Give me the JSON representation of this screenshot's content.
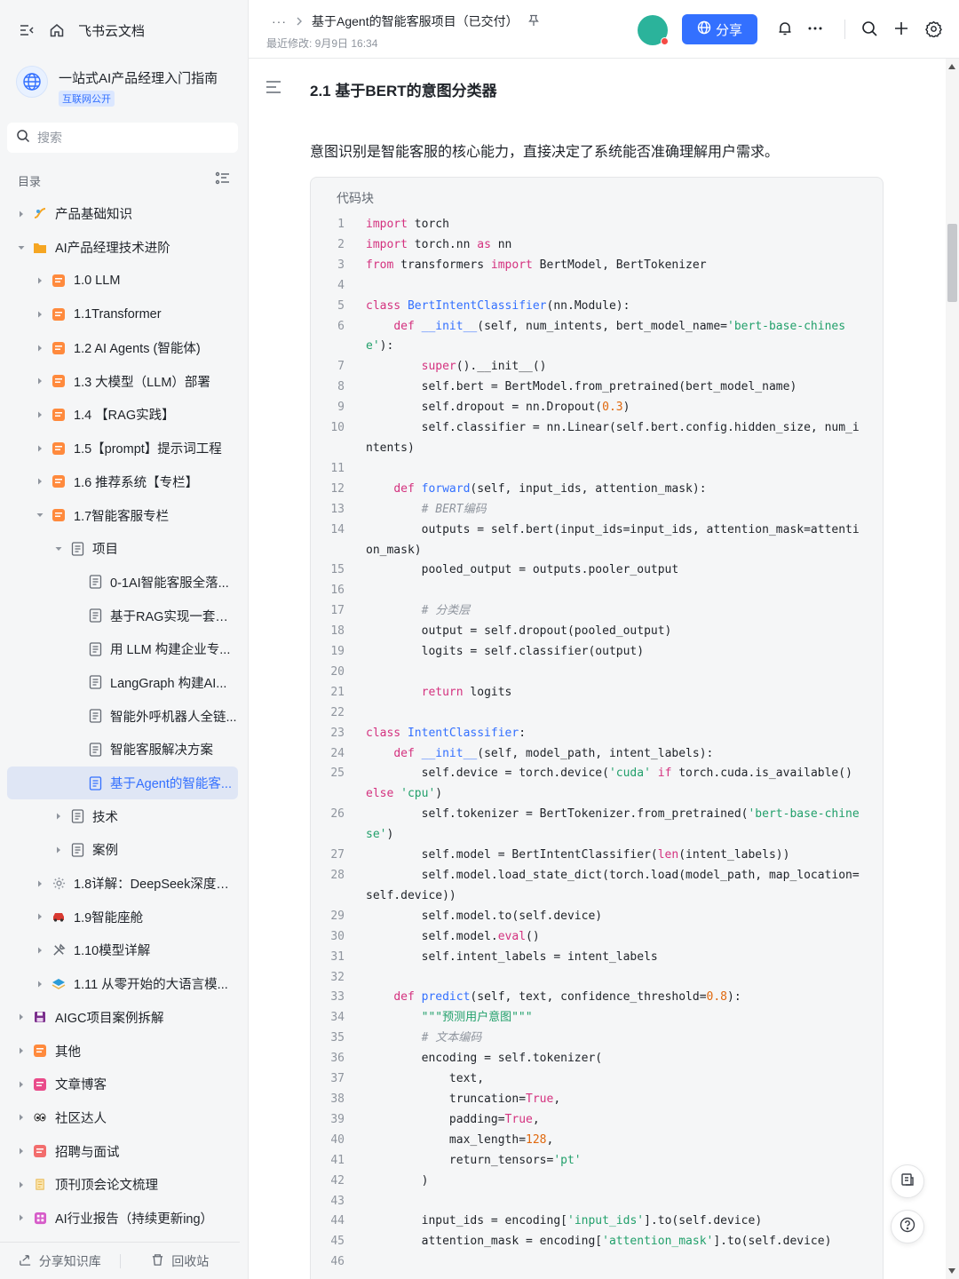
{
  "sidebar": {
    "brand": "飞书云文档",
    "kb_title": "一站式AI产品经理入门指南",
    "kb_badge": "互联网公开",
    "search_placeholder": "搜索",
    "toc_label": "目录",
    "tree": [
      {
        "label": "产品基础知识",
        "level": 0,
        "arrow": "right",
        "icon": "light-icon",
        "color": "#f5a623"
      },
      {
        "label": "AI产品经理技术进阶",
        "level": 0,
        "arrow": "down",
        "icon": "folder-icon",
        "color": "#f5a623"
      },
      {
        "label": "1.0 LLM",
        "level": 1,
        "arrow": "right",
        "icon": "doc-icon",
        "color": "#ff8a3d"
      },
      {
        "label": "1.1Transformer",
        "level": 1,
        "arrow": "right",
        "icon": "doc-icon",
        "color": "#ff8a3d"
      },
      {
        "label": "1.2 AI Agents (智能体)",
        "level": 1,
        "arrow": "right",
        "icon": "doc-icon",
        "color": "#ff8a3d"
      },
      {
        "label": "1.3 大模型（LLM）部署",
        "level": 1,
        "arrow": "right",
        "icon": "doc-icon",
        "color": "#ff8a3d"
      },
      {
        "label": "1.4 【RAG实践】",
        "level": 1,
        "arrow": "right",
        "icon": "doc-icon",
        "color": "#ff8a3d"
      },
      {
        "label": "1.5【prompt】提示词工程",
        "level": 1,
        "arrow": "right",
        "icon": "doc-icon",
        "color": "#ff8a3d"
      },
      {
        "label": "1.6 推荐系统【专栏】",
        "level": 1,
        "arrow": "right",
        "icon": "doc-icon",
        "color": "#ff8a3d"
      },
      {
        "label": "1.7智能客服专栏",
        "level": 1,
        "arrow": "down",
        "icon": "doc-icon",
        "color": "#ff8a3d"
      },
      {
        "label": "项目",
        "level": 2,
        "arrow": "down",
        "icon": "page-icon",
        "color": "#646a73"
      },
      {
        "label": "0-1AI智能客服全落...",
        "level": 3,
        "arrow": "none",
        "icon": "page-icon",
        "color": "#646a73"
      },
      {
        "label": "基于RAG实现一套企...",
        "level": 3,
        "arrow": "none",
        "icon": "page-icon",
        "color": "#646a73"
      },
      {
        "label": "用 LLM 构建企业专...",
        "level": 3,
        "arrow": "none",
        "icon": "page-icon",
        "color": "#646a73"
      },
      {
        "label": "LangGraph 构建AI...",
        "level": 3,
        "arrow": "none",
        "icon": "page-icon",
        "color": "#646a73"
      },
      {
        "label": "智能外呼机器人全链...",
        "level": 3,
        "arrow": "none",
        "icon": "page-icon",
        "color": "#646a73"
      },
      {
        "label": "智能客服解决方案",
        "level": 3,
        "arrow": "none",
        "icon": "page-icon",
        "color": "#646a73"
      },
      {
        "label": "基于Agent的智能客...",
        "level": 3,
        "arrow": "none",
        "icon": "page-icon",
        "color": "#3370ff",
        "active": true
      },
      {
        "label": "技术",
        "level": 2,
        "arrow": "right",
        "icon": "page-icon",
        "color": "#646a73"
      },
      {
        "label": "案例",
        "level": 2,
        "arrow": "right",
        "icon": "page-icon",
        "color": "#646a73"
      },
      {
        "label": "1.8详解：DeepSeek深度推...",
        "level": 1,
        "arrow": "right",
        "icon": "gear-icon",
        "color": "#8f959e"
      },
      {
        "label": "1.9智能座舱",
        "level": 1,
        "arrow": "right",
        "icon": "car-icon",
        "color": "#d83931"
      },
      {
        "label": "1.10模型详解",
        "level": 1,
        "arrow": "right",
        "icon": "tools-icon",
        "color": "#646a73"
      },
      {
        "label": "1.11 从零开始的大语言模...",
        "level": 1,
        "arrow": "right",
        "icon": "layers-icon",
        "color": "#2b9cd8"
      },
      {
        "label": "AIGC项目案例拆解",
        "level": 0,
        "arrow": "right",
        "icon": "save-icon",
        "color": "#7a2e8c"
      },
      {
        "label": "其他",
        "level": 0,
        "arrow": "right",
        "icon": "doc-icon",
        "color": "#ff8a3d"
      },
      {
        "label": "文章博客",
        "level": 0,
        "arrow": "right",
        "icon": "doc-icon",
        "color": "#e94b8a"
      },
      {
        "label": "社区达人",
        "level": 0,
        "arrow": "right",
        "icon": "eyes-icon",
        "color": "#1f2329"
      },
      {
        "label": "招聘与面试",
        "level": 0,
        "arrow": "right",
        "icon": "doc-icon",
        "color": "#f26d6d"
      },
      {
        "label": "顶刊顶会论文梳理",
        "level": 0,
        "arrow": "right",
        "icon": "scroll-icon",
        "color": "#e8b54a"
      },
      {
        "label": "AI行业报告（持续更新ing）",
        "level": 0,
        "arrow": "right",
        "icon": "grid-icon",
        "color": "#d65cc9"
      }
    ],
    "bottom": {
      "share_label": "分享知识库",
      "trash_label": "回收站"
    }
  },
  "header": {
    "breadcrumb_ellipsis": "···",
    "doc_title": "基于Agent的智能客服项目（已交付）",
    "modified": "最近修改: 9月9日 16:34",
    "share_label": "分享"
  },
  "content": {
    "heading": "2.1 基于BERT的意图分类器",
    "paragraph": "意图识别是智能客服的核心能力，直接决定了系统能否准确理解用户需求。",
    "code_block_title": "代码块",
    "code_lines": [
      "1",
      "2",
      "3",
      "4",
      "5",
      "6",
      "7",
      "8",
      "9",
      "10",
      "11",
      "12",
      "13",
      "14",
      "15",
      "16",
      "17",
      "18",
      "19",
      "20",
      "21",
      "22",
      "23",
      "24",
      "25",
      "26",
      "27",
      "28",
      "29",
      "30",
      "31",
      "32",
      "33",
      "34",
      "35",
      "36",
      "37",
      "38",
      "39",
      "40",
      "41",
      "42",
      "43",
      "44",
      "45",
      "46"
    ],
    "code_text": [
      "import torch",
      "import torch.nn as nn",
      "from transformers import BertModel, BertTokenizer",
      "",
      "class BertIntentClassifier(nn.Module):",
      "    def __init__(self, num_intents, bert_model_name='bert-base-chinese'):",
      "        super().__init__()",
      "        self.bert = BertModel.from_pretrained(bert_model_name)",
      "        self.dropout = nn.Dropout(0.3)",
      "        self.classifier = nn.Linear(self.bert.config.hidden_size, num_intents)",
      "",
      "    def forward(self, input_ids, attention_mask):",
      "        # BERT编码",
      "        outputs = self.bert(input_ids=input_ids, attention_mask=attention_mask)",
      "        pooled_output = outputs.pooler_output",
      "",
      "        # 分类层",
      "        output = self.dropout(pooled_output)",
      "        logits = self.classifier(output)",
      "",
      "        return logits",
      "",
      "class IntentClassifier:",
      "    def __init__(self, model_path, intent_labels):",
      "        self.device = torch.device('cuda' if torch.cuda.is_available() else 'cpu')",
      "        self.tokenizer = BertTokenizer.from_pretrained('bert-base-chinese')",
      "        self.model = BertIntentClassifier(len(intent_labels))",
      "        self.model.load_state_dict(torch.load(model_path, map_location=self.device))",
      "        self.model.to(self.device)",
      "        self.model.eval()",
      "        self.intent_labels = intent_labels",
      "",
      "    def predict(self, text, confidence_threshold=0.8):",
      "        \"\"\"预测用户意图\"\"\"",
      "        # 文本编码",
      "        encoding = self.tokenizer(",
      "            text,",
      "            truncation=True,",
      "            padding=True,",
      "            max_length=128,",
      "            return_tensors='pt'",
      "        )",
      "",
      "        input_ids = encoding['input_ids'].to(self.device)",
      "        attention_mask = encoding['attention_mask'].to(self.device)",
      ""
    ]
  },
  "colors": {
    "accent": "#3370ff",
    "keyword": "#d4327f",
    "function": "#3370ff",
    "string": "#22a06b",
    "number": "#e0680d",
    "comment": "#8f959e"
  }
}
